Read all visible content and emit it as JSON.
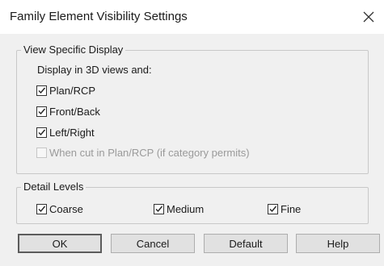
{
  "window": {
    "title": "Family Element Visibility Settings",
    "close_glyph": "close-icon"
  },
  "view_specific": {
    "group_label": "View Specific Display",
    "sublabel": "Display in 3D views and:",
    "options": [
      {
        "label": "Plan/RCP",
        "checked": true,
        "enabled": true
      },
      {
        "label": "Front/Back",
        "checked": true,
        "enabled": true
      },
      {
        "label": "Left/Right",
        "checked": true,
        "enabled": true
      },
      {
        "label": "When cut in Plan/RCP (if category permits)",
        "checked": false,
        "enabled": false
      }
    ]
  },
  "detail_levels": {
    "group_label": "Detail Levels",
    "options": [
      {
        "label": "Coarse",
        "checked": true
      },
      {
        "label": "Medium",
        "checked": true
      },
      {
        "label": "Fine",
        "checked": true
      }
    ]
  },
  "buttons": {
    "ok": "OK",
    "cancel": "Cancel",
    "default": "Default",
    "help": "Help"
  },
  "colors": {
    "dialog_bg": "#f0f0f0",
    "titlebar_bg": "#ffffff",
    "button_bg": "#e1e1e1",
    "disabled_text": "#9a9a9a"
  }
}
